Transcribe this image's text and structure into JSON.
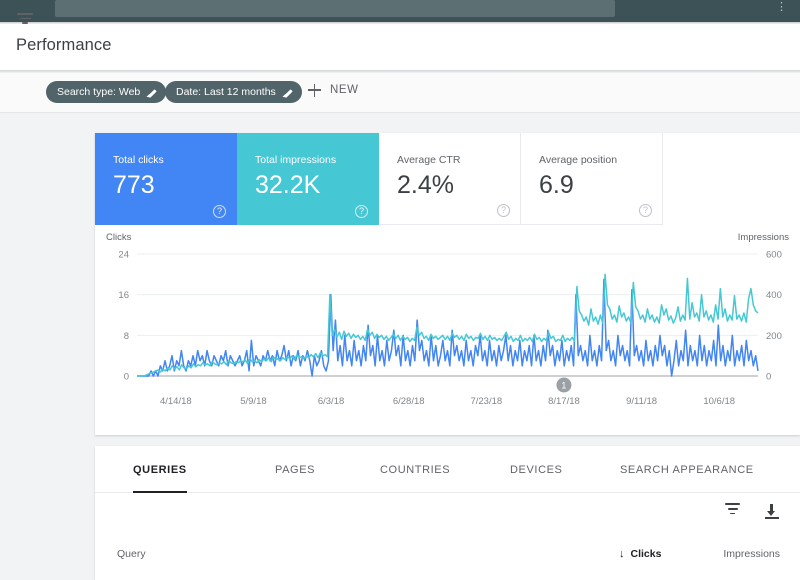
{
  "appbar": {
    "search_placeholder": "",
    "menu_icon": "more-vert-icon"
  },
  "header": {
    "title": "Performance"
  },
  "filterbar": {
    "filter_icon": "filter-icon",
    "chips": [
      {
        "label": "Search type: Web",
        "edit_icon": "pencil-icon"
      },
      {
        "label": "Date: Last 12 months",
        "edit_icon": "pencil-icon"
      }
    ],
    "new_button": {
      "label": "NEW",
      "icon": "plus-icon"
    }
  },
  "metrics": {
    "cards": [
      {
        "label": "Total clicks",
        "value": "773",
        "color": "#4285f4",
        "help": "?"
      },
      {
        "label": "Total impressions",
        "value": "32.2K",
        "color": "#46c8d4",
        "help": "?"
      },
      {
        "label": "Average CTR",
        "value": "2.4%",
        "color": "#ffffff",
        "help": "?"
      },
      {
        "label": "Average position",
        "value": "6.9",
        "color": "#ffffff",
        "help": "?"
      }
    ]
  },
  "chart_data": {
    "type": "line",
    "title": "",
    "xlabel": "",
    "ylabel": "Clicks",
    "y2label": "Impressions",
    "ylim": [
      0,
      24
    ],
    "y2lim": [
      0,
      600
    ],
    "yticks": [
      "0",
      "8",
      "16",
      "24"
    ],
    "y2ticks": [
      "0",
      "200",
      "400",
      "600"
    ],
    "grid": true,
    "legend": "none",
    "xticks": [
      "4/14/18",
      "5/9/18",
      "6/3/18",
      "6/28/18",
      "7/23/18",
      "8/17/18",
      "9/11/18",
      "10/6/18"
    ],
    "annotations": [
      {
        "label": "1",
        "x": "8/17/18"
      }
    ],
    "series": [
      {
        "name": "Clicks",
        "color": "#4285f4",
        "axis": "left",
        "values": [
          0,
          0,
          0,
          0,
          0,
          0,
          1,
          0,
          1,
          0,
          2,
          1,
          3,
          1,
          2,
          4,
          1,
          3,
          2,
          5,
          2,
          1,
          3,
          2,
          4,
          2,
          5,
          3,
          4,
          2,
          5,
          3,
          2,
          4,
          3,
          2,
          4,
          3,
          5,
          2,
          4,
          3,
          2,
          3,
          4,
          2,
          3,
          5,
          1,
          7,
          2,
          4,
          3,
          2,
          4,
          3,
          5,
          3,
          4,
          2,
          5,
          3,
          4,
          6,
          3,
          5,
          2,
          4,
          3,
          5,
          2,
          4,
          3,
          5,
          3,
          0,
          4,
          2,
          3,
          5,
          2,
          1,
          3,
          16,
          5,
          11,
          3,
          6,
          2,
          8,
          3,
          5,
          2,
          7,
          3,
          5,
          2,
          6,
          3,
          10,
          4,
          6,
          2,
          8,
          3,
          5,
          2,
          7,
          3,
          5,
          9,
          4,
          6,
          2,
          8,
          3,
          5,
          2,
          6,
          3,
          11,
          5,
          7,
          3,
          5,
          2,
          8,
          3,
          6,
          2,
          4,
          7,
          3,
          5,
          2,
          9,
          4,
          6,
          3,
          5,
          2,
          7,
          3,
          5,
          2,
          6,
          4,
          8,
          3,
          5,
          2,
          7,
          3,
          5,
          2,
          6,
          3,
          5,
          8,
          3,
          6,
          2,
          5,
          3,
          7,
          2,
          5,
          3,
          6,
          2,
          8,
          3,
          5,
          2,
          6,
          3,
          9,
          4,
          6,
          2,
          5,
          3,
          7,
          2,
          5,
          3,
          6,
          2,
          16,
          4,
          6,
          3,
          5,
          2,
          8,
          3,
          5,
          2,
          6,
          3,
          19,
          5,
          7,
          3,
          5,
          2,
          8,
          4,
          6,
          3,
          5,
          2,
          17,
          4,
          6,
          3,
          5,
          2,
          7,
          3,
          5,
          2,
          6,
          3,
          8,
          4,
          6,
          2,
          5,
          0,
          3,
          7,
          2,
          5,
          3,
          9,
          2,
          6,
          3,
          5,
          2,
          8,
          3,
          6,
          2,
          5,
          3,
          7,
          2,
          10,
          3,
          6,
          2,
          5,
          3,
          8,
          2,
          5,
          3,
          6,
          2,
          7,
          3,
          5,
          2,
          4,
          1
        ]
      },
      {
        "name": "Impressions",
        "color": "#46c8d4",
        "axis": "right",
        "values": [
          0,
          0,
          0,
          0,
          5,
          10,
          15,
          20,
          25,
          30,
          20,
          35,
          25,
          40,
          30,
          50,
          35,
          45,
          30,
          55,
          40,
          35,
          50,
          40,
          60,
          45,
          55,
          50,
          65,
          55,
          60,
          50,
          70,
          60,
          55,
          65,
          60,
          70,
          55,
          75,
          65,
          60,
          70,
          65,
          75,
          70,
          80,
          60,
          85,
          70,
          75,
          65,
          80,
          70,
          85,
          75,
          90,
          70,
          95,
          80,
          85,
          75,
          90,
          80,
          95,
          85,
          100,
          80,
          105,
          90,
          95,
          85,
          100,
          90,
          105,
          95,
          110,
          90,
          115,
          100,
          105,
          95,
          400,
          200,
          230,
          190,
          215,
          180,
          220,
          195,
          210,
          185,
          205,
          190,
          200,
          180,
          195,
          175,
          230,
          200,
          215,
          185,
          205,
          190,
          200,
          180,
          195,
          175,
          190,
          205,
          185,
          200,
          175,
          195,
          180,
          190,
          170,
          185,
          175,
          240,
          200,
          215,
          185,
          195,
          175,
          205,
          185,
          195,
          180,
          190,
          200,
          180,
          195,
          175,
          210,
          190,
          200,
          180,
          195,
          175,
          205,
          185,
          195,
          175,
          190,
          185,
          210,
          180,
          195,
          175,
          200,
          180,
          190,
          175,
          185,
          175,
          195,
          215,
          180,
          195,
          170,
          185,
          175,
          200,
          170,
          185,
          175,
          190,
          170,
          205,
          180,
          190,
          170,
          185,
          175,
          215,
          185,
          195,
          170,
          180,
          175,
          200,
          170,
          185,
          175,
          190,
          170,
          440,
          320,
          300,
          270,
          290,
          250,
          330,
          270,
          290,
          255,
          300,
          260,
          500,
          350,
          330,
          280,
          300,
          265,
          345,
          290,
          310,
          270,
          290,
          260,
          460,
          340,
          320,
          280,
          300,
          265,
          330,
          280,
          300,
          265,
          290,
          260,
          350,
          300,
          330,
          275,
          295,
          260,
          285,
          340,
          270,
          300,
          275,
          480,
          280,
          360,
          290,
          310,
          270,
          400,
          290,
          320,
          275,
          300,
          265,
          350,
          280,
          430,
          290,
          330,
          270,
          300,
          275,
          395,
          280,
          300,
          270,
          310,
          265,
          380,
          430,
          350,
          320,
          310
        ]
      }
    ]
  },
  "table": {
    "tabs": [
      {
        "label": "QUERIES",
        "active": true
      },
      {
        "label": "PAGES",
        "active": false
      },
      {
        "label": "COUNTRIES",
        "active": false
      },
      {
        "label": "DEVICES",
        "active": false
      },
      {
        "label": "SEARCH APPEARANCE",
        "active": false
      }
    ],
    "tools": [
      {
        "name": "filter-icon"
      },
      {
        "name": "download-icon"
      }
    ],
    "columns": {
      "query": "Query",
      "clicks": "Clicks",
      "clicks_sort_arrow": "↓",
      "impressions": "Impressions"
    },
    "rows": []
  }
}
